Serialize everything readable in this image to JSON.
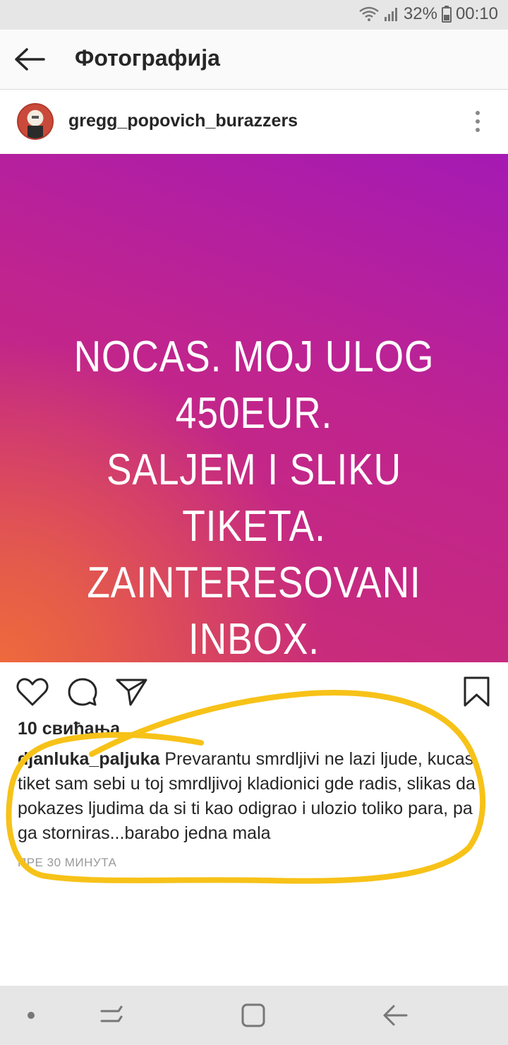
{
  "status_bar": {
    "battery": "32%",
    "time": "00:10",
    "icons": [
      "wifi-icon",
      "signal-icon",
      "battery-icon"
    ]
  },
  "app_bar": {
    "title": "Фотографија",
    "back_icon": "back-arrow-icon"
  },
  "post": {
    "username": "gregg_popovich_burazzers",
    "image_text": [
      "NOCAS. MOJ ULOG 450EUR.",
      "SALJEM I SLIKU TIKETA.",
      "ZAINTERESOVANI INBOX."
    ],
    "likes": "10 свиђања",
    "caption_user": "djanluka_paljuka",
    "caption_text": " Prevarantu smrdljivi ne lazi ljude, kucas tiket sam sebi u toj smrdljivoj kladionici gde radis, slikas da pokazes ljudima da si ti kao odigrao i ulozio toliko para, pa ga storniras...barabo jedna mala",
    "time_ago": "ПРЕ 30 МИНУТА"
  },
  "actions": [
    "heart-icon",
    "comment-icon",
    "share-icon",
    "bookmark-icon"
  ],
  "colors": {
    "gradient_purple": "#a51ab4",
    "gradient_pink": "#cc2f72",
    "gradient_orange": "#ee6a3c",
    "highlight_yellow": "#f7c218"
  },
  "nav_bar": [
    "dot-icon",
    "recent-apps-icon",
    "home-icon",
    "back-icon"
  ]
}
